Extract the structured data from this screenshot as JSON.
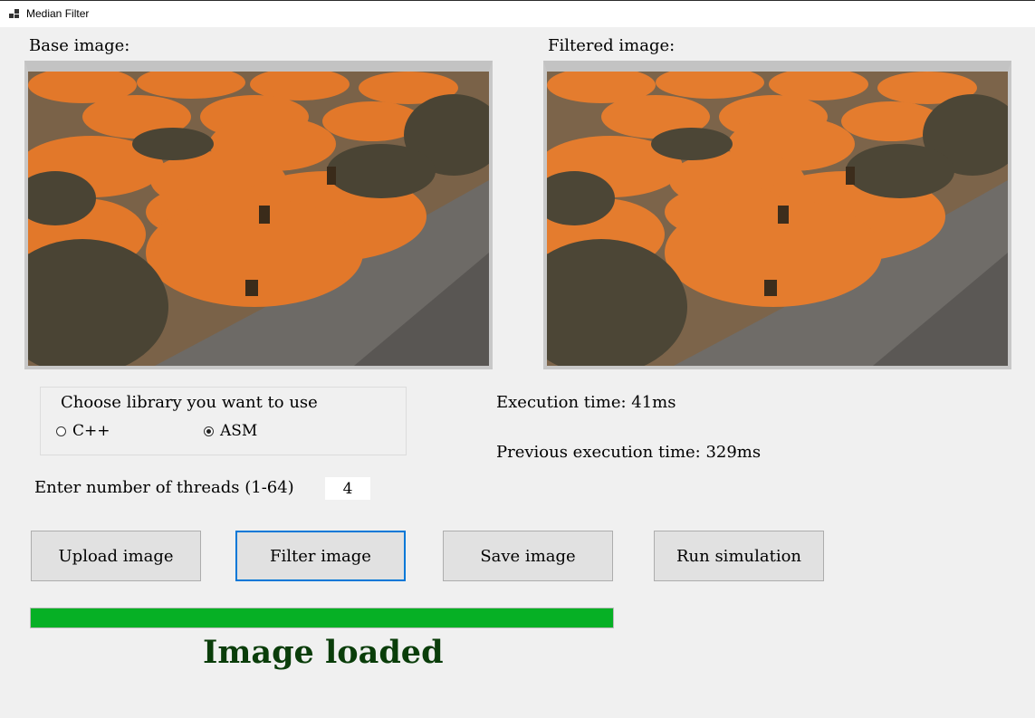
{
  "window": {
    "title": "Median Filter",
    "icon": "app-window-icon"
  },
  "images": {
    "base_label": "Base image:",
    "filtered_label": "Filtered image:"
  },
  "library": {
    "legend": "Choose library you want to use",
    "options": [
      {
        "label": "C++",
        "checked": false
      },
      {
        "label": "ASM",
        "checked": true
      }
    ]
  },
  "timing": {
    "execution": "Execution time: 41ms",
    "previous": "Previous execution time: 329ms"
  },
  "threads": {
    "label": "Enter number of threads (1-64)",
    "value": "4"
  },
  "buttons": {
    "upload": "Upload image",
    "filter": "Filter image",
    "save": "Save image",
    "simulate": "Run simulation"
  },
  "progress": {
    "percent": 100,
    "color": "#06b025"
  },
  "status": {
    "text": "Image loaded",
    "color": "#0a3d0a"
  }
}
